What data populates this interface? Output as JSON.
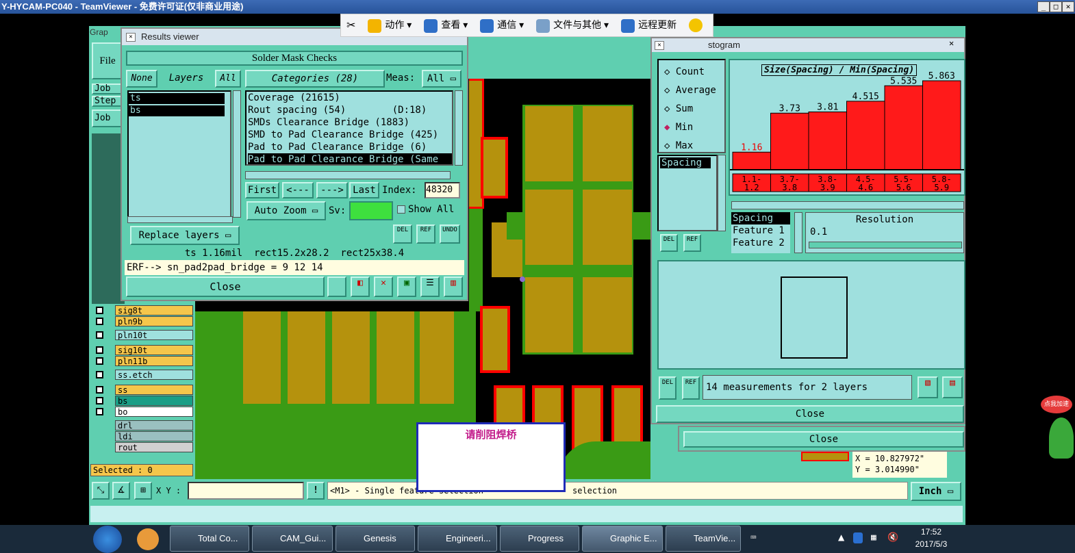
{
  "teamviewer": {
    "title": "Y-HYCAM-PC040 - TeamViewer - 免费许可证(仅非商业用途)",
    "toolbar": [
      {
        "label": "动作",
        "icon": "lightning-icon"
      },
      {
        "label": "查看",
        "icon": "monitor-icon"
      },
      {
        "label": "通信",
        "icon": "phone-icon"
      },
      {
        "label": "文件与其他",
        "icon": "file-icon"
      },
      {
        "label": "远程更新",
        "icon": "download-icon"
      }
    ]
  },
  "genesis": {
    "title_stub": "Grap",
    "file_menu": "File",
    "left_buttons": [
      "Job",
      "Step",
      "Job"
    ],
    "layers": [
      {
        "name": "sig8t",
        "color": "#f5c64b"
      },
      {
        "name": "pln9b",
        "color": "#f5c64b"
      },
      {
        "name": "pln10t",
        "color": "#9fe0de"
      },
      {
        "name": "sig10t",
        "color": "#f5c64b"
      },
      {
        "name": "pln11b",
        "color": "#f5c64b"
      },
      {
        "name": "ss.etch",
        "color": "#9fe0de"
      },
      {
        "name": "ss",
        "color": "#f5c64b"
      },
      {
        "name": "bs",
        "color": "#1a9e86"
      },
      {
        "name": "bo",
        "color": "#ffffff"
      },
      {
        "name": "drl",
        "color": "#9ac0c0"
      },
      {
        "name": "ldi",
        "color": "#9ac0c0"
      },
      {
        "name": "rout",
        "color": "#d0d0d0"
      }
    ],
    "selected": "Selected : 0",
    "xy_label": "X Y :",
    "status_msg": "<M1> - Single feature selection",
    "status_right": "selection",
    "units": "Inch",
    "coords": {
      "x": "X = 10.827972\"",
      "y": "Y = 3.014990\""
    },
    "note": "请削阻焊桥"
  },
  "results": {
    "window_title": "Results viewer",
    "header": "Solder Mask Checks",
    "none_btn": "None",
    "layers_label": "Layers",
    "all_btn": "All",
    "layer_list": [
      "ts",
      "bs"
    ],
    "categories_label": "Categories (28)",
    "meas_label": "Meas:",
    "meas_value": "All",
    "categories": [
      "Coverage (21615)",
      "Rout spacing (54)        (D:18)",
      "SMDs Clearance Bridge (1883)",
      "SMD to Pad Clearance Bridge (425)",
      "Pad to Pad Clearance Bridge (6)",
      "Pad to Pad Clearance Bridge (Same"
    ],
    "nav": [
      "First",
      "<---",
      "--->",
      "Last"
    ],
    "index_label": "Index:",
    "index_value": "48320",
    "auto_zoom": "Auto Zoom",
    "sv_label": "Sv:",
    "show_all": "Show All",
    "replace_layers": "Replace layers",
    "small_btns": [
      "DEL",
      "REF",
      "UNDO"
    ],
    "info": "ts 1.16mil  rect15.2x28.2  rect25x38.4",
    "erf": "ERF--> sn_pad2pad_bridge = 9 12 14",
    "close": "Close"
  },
  "histogram": {
    "title_suffix": "stogram",
    "modes": [
      "Count",
      "Average",
      "Sum",
      "Min",
      "Max"
    ],
    "selected_mode": "Min",
    "list": [
      "Spacing"
    ],
    "feature_list": [
      "Spacing",
      "Feature 1",
      "Feature 2"
    ],
    "resolution_label": "Resolution",
    "resolution_value": "0.1",
    "measurements": "14 measurements for 2 layers",
    "close": "Close",
    "close2": "Close",
    "small_btns": [
      "DEL",
      "REF"
    ]
  },
  "chart_data": {
    "type": "bar",
    "title": "Size(Spacing) / Min(Spacing)",
    "categories": [
      "1.1-1.2",
      "3.7-3.8",
      "3.8-3.9",
      "4.5-4.6",
      "5.5-5.6",
      "5.8-5.9"
    ],
    "category_labels_top": [
      "1.1-",
      "3.7-",
      "3.8-",
      "4.5-",
      "5.5-",
      "5.8-"
    ],
    "category_labels_bottom": [
      "1.2",
      "3.8",
      "3.9",
      "4.6",
      "5.6",
      "5.9"
    ],
    "values": [
      1.16,
      3.73,
      3.81,
      4.515,
      5.535,
      5.863
    ],
    "value_labels": [
      "1.16",
      "3.73",
      "3.81",
      "4.515",
      "5.535",
      "5.863"
    ],
    "bar_color": "#ff1a1a",
    "ylim": [
      0,
      5.863
    ]
  },
  "taskbar": {
    "items": [
      "Total Co...",
      "CAM_Gui...",
      "Genesis",
      "Engineeri...",
      "Progress",
      "Graphic E...",
      "TeamVie..."
    ],
    "time": "17:52",
    "date": "2017/5/3"
  }
}
